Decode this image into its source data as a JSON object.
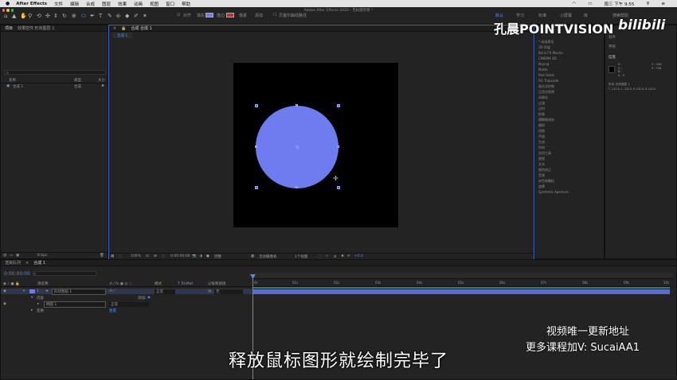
{
  "menubar": {
    "apple": "",
    "items": [
      "After Effects",
      "文件",
      "编辑",
      "合成",
      "图层",
      "效果",
      "动画",
      "视图",
      "窗口",
      "帮助"
    ],
    "clock": "周三 下午 9:55"
  },
  "window_title": "Adobe After Effects 2020 - 无标题项目 *",
  "toolbar": {
    "snap_label": "对齐",
    "fill_label": "填充",
    "stroke_label": "描边",
    "stroke_width": "像素",
    "add_label": "添加",
    "bezier_label": "贝塞尔曲线路径",
    "workspaces": [
      "默认",
      "学习",
      "标准",
      "小屏幕",
      "库"
    ],
    "search_placeholder": "搜索帮助"
  },
  "project_panel": {
    "tab_project": "项目",
    "tab_effects_controls": "效果控件 形状图层 1",
    "columns": {
      "name": "名称",
      "type": "类型",
      "size": "大小"
    },
    "items": [
      {
        "name": "合成 1",
        "type": "合成"
      }
    ],
    "bpc": "8 bpc"
  },
  "comp_panel": {
    "tab": "合成 合成 1",
    "breadcrumb": "合成 1",
    "zoom": "100%",
    "timecode": "0:00:00:00",
    "resolution": "完整",
    "camera": "活动摄像机",
    "views": "1个视图",
    "exposure": "+0.0"
  },
  "effects_panel": {
    "items": [
      "* 动画预设",
      "3D 声道",
      "Boris FX Mocha",
      "CINEMA 4D",
      "Keying",
      "Matte",
      "Red Giant",
      "RG Trapcode",
      "表达式控制",
      "沉浸式视频",
      "风格化",
      "过渡",
      "过时",
      "抠像",
      "模糊和锐化",
      "模拟",
      "扭曲",
      "声道",
      "生成",
      "时间",
      "实用工具",
      "透视",
      "文本",
      "颜色校正",
      "音频",
      "杂色和颗粒",
      "遮罩",
      "Synthetic Aperture"
    ]
  },
  "info_panel": {
    "tabs": [
      "对齐",
      "字符",
      "信息"
    ],
    "x": "X : 458",
    "y": "Y : 708",
    "r": "R :",
    "g": "G :",
    "b": "B :",
    "a": "A : 0",
    "layer_info": "形状: 形状图层 1",
    "layer_coords": "T -242.0, L -242.0, R 242.0, B 242.0"
  },
  "timeline": {
    "tab_render": "渲染队列",
    "tab_comp": "合成 1",
    "timecode": "0:00:00:00",
    "col_source": "源名称",
    "col_mode": "模式",
    "col_trkmat": "T TrkMat",
    "col_parent": "父级和链接",
    "layer_num": "1",
    "layer_name": "形状图层 1",
    "layer_mode": "正常",
    "layer_parent": "无",
    "contents": "内容",
    "add": "添加:",
    "ellipse": "椭圆 1",
    "ellipse_mode": "正常",
    "transform": "变换",
    "reset": "重置",
    "ruler": [
      "0s",
      "01s",
      "02s",
      "03s",
      "04s",
      "05s",
      "06s",
      "07s",
      "08s",
      "09s",
      "10s"
    ]
  },
  "watermark": {
    "brand": "孔晨POINTVISION",
    "bili": "bilibili",
    "promo1": "视频唯一更新地址",
    "promo2": "更多课程加V: SucaiAA1"
  },
  "subtitle": "释放鼠标图形就绘制完毕了",
  "colors": {
    "ellipse_fill": "#6e7cf0",
    "selection": "#3f6fff",
    "timecode": "#4a8df0",
    "layer_bar": "#5b6bd6"
  }
}
